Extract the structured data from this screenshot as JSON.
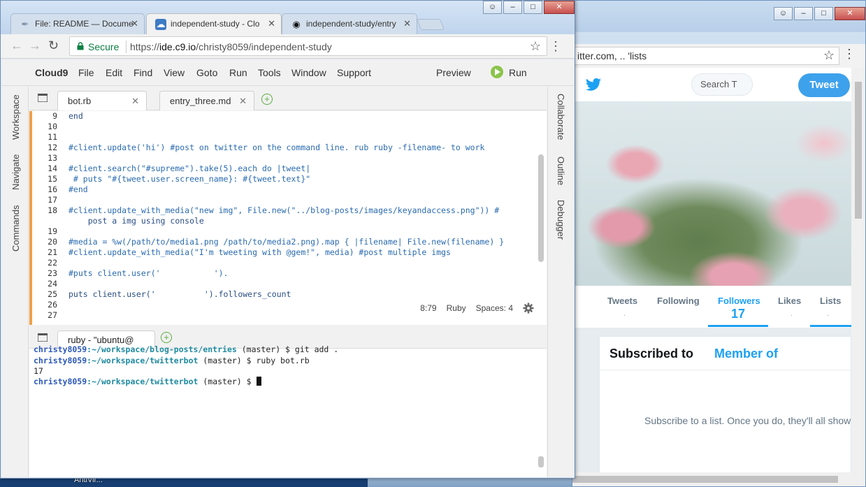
{
  "desktop": {
    "icon_label": "AntiVir..."
  },
  "chrome": {
    "tabs": [
      {
        "title": "File: README — Docume",
        "icon": "document-icon"
      },
      {
        "title": "independent-study - Clo",
        "icon": "cloud9-icon"
      },
      {
        "title": "independent-study/entry",
        "icon": "github-icon"
      }
    ],
    "secure_label": "Secure",
    "url_scheme": "https://",
    "url_host": "ide.c9.io",
    "url_path": "/christy8059/independent-study"
  },
  "cloud9": {
    "menu": [
      "Cloud9",
      "File",
      "Edit",
      "Find",
      "View",
      "Goto",
      "Run",
      "Tools",
      "Window",
      "Support"
    ],
    "preview_label": "Preview",
    "run_label": "Run",
    "left_rail": [
      "Workspace",
      "Navigate",
      "Commands"
    ],
    "right_rail": [
      "Collaborate",
      "Outline",
      "Debugger"
    ],
    "editor_tabs": [
      {
        "label": "bot.rb"
      },
      {
        "label": "entry_three.md"
      }
    ],
    "code_lines": [
      {
        "n": "9",
        "text": "end"
      },
      {
        "n": "10",
        "text": ""
      },
      {
        "n": "11",
        "text": ""
      },
      {
        "n": "12",
        "text": "#client.update('hi') #post on twitter on the command line. rub ruby -filename- to work"
      },
      {
        "n": "13",
        "text": ""
      },
      {
        "n": "14",
        "text": "#client.search(\"#supreme\").take(5).each do |tweet|"
      },
      {
        "n": "15",
        "text": " # puts \"#{tweet.user.screen_name}: #{tweet.text}\""
      },
      {
        "n": "16",
        "text": "#end"
      },
      {
        "n": "17",
        "text": ""
      },
      {
        "n": "18",
        "text": "#client.update_with_media(\"new img\", File.new(\"../blog-posts/images/keyandaccess.png\")) #"
      },
      {
        "n": "",
        "text": "    post a img using console"
      },
      {
        "n": "19",
        "text": ""
      },
      {
        "n": "20",
        "text": "#media = %w(/path/to/media1.png /path/to/media2.png).map { |filename| File.new(filename) }"
      },
      {
        "n": "21",
        "text": "#client.update_with_media(\"I'm tweeting with @gem!\", media) #post multiple imgs"
      },
      {
        "n": "22",
        "text": ""
      },
      {
        "n": "23",
        "text": "#puts client.user('           ')."
      },
      {
        "n": "24",
        "text": ""
      },
      {
        "n": "25",
        "text": "puts client.user('          ').followers_count"
      },
      {
        "n": "26",
        "text": ""
      },
      {
        "n": "27",
        "text": ""
      }
    ],
    "status": {
      "cursor": "8:79",
      "language": "Ruby",
      "spaces": "Spaces: 4"
    },
    "terminal_tab": "ruby - \"ubuntu@",
    "terminal_lines": [
      {
        "user": "christy8059",
        "path": ":~/workspace/blog-posts/entries",
        "rest": " (master) $ git add ."
      },
      {
        "user": "christy8059",
        "path": ":~/workspace/twitterbot",
        "rest": " (master) $ ruby bot.rb"
      },
      {
        "plain": "17"
      },
      {
        "user": "christy8059",
        "path": ":~/workspace/twitterbot",
        "rest": " (master) $ "
      }
    ]
  },
  "twitter": {
    "omnibox": "itter.com,  ..          'lists",
    "search_placeholder": "Search T",
    "tweet_button": "Tweet",
    "nav": [
      {
        "label": "Tweets",
        "value": "."
      },
      {
        "label": "Following",
        "value": ""
      },
      {
        "label": "Followers",
        "value": "17"
      },
      {
        "label": "Likes",
        "value": "."
      },
      {
        "label": "Lists",
        "value": "."
      }
    ],
    "lists_tabs": {
      "subscribed": "Subscribed to",
      "member": "Member of"
    },
    "empty_message": "Subscribe to a list. Once you do, they'll all show"
  },
  "colors": {
    "twitter_blue": "#1da1f2",
    "c9_accent": "#f0a048",
    "run_green": "#8ac44b"
  }
}
